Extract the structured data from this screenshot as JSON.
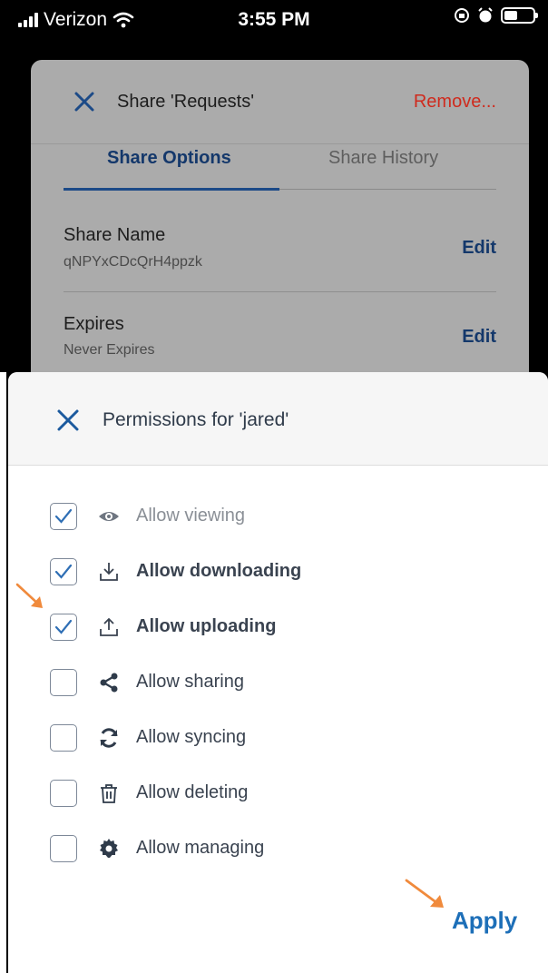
{
  "status_bar": {
    "carrier": "Verizon",
    "time": "3:55 PM"
  },
  "share_panel": {
    "title": "Share 'Requests'",
    "remove_label": "Remove...",
    "tabs": [
      {
        "label": "Share Options",
        "active": true
      },
      {
        "label": "Share History",
        "active": false
      }
    ],
    "fields": [
      {
        "label": "Share Name",
        "value": "qNPYxCDcQrH4ppzk",
        "action": "Edit"
      },
      {
        "label": "Expires",
        "value": "Never Expires",
        "action": "Edit"
      }
    ]
  },
  "permissions_sheet": {
    "title": "Permissions for 'jared'",
    "items": [
      {
        "label": "Allow viewing",
        "checked": true,
        "icon": "eye-icon"
      },
      {
        "label": "Allow downloading",
        "checked": true,
        "icon": "download-icon"
      },
      {
        "label": "Allow uploading",
        "checked": true,
        "icon": "upload-icon"
      },
      {
        "label": "Allow sharing",
        "checked": false,
        "icon": "share-icon"
      },
      {
        "label": "Allow syncing",
        "checked": false,
        "icon": "sync-icon"
      },
      {
        "label": "Allow deleting",
        "checked": false,
        "icon": "trash-icon"
      },
      {
        "label": "Allow managing",
        "checked": false,
        "icon": "gear-icon"
      }
    ],
    "apply_label": "Apply"
  },
  "colors": {
    "accent": "#1d6fb8",
    "destructive": "#cf2b1e",
    "annotation": "#f08a3c"
  }
}
